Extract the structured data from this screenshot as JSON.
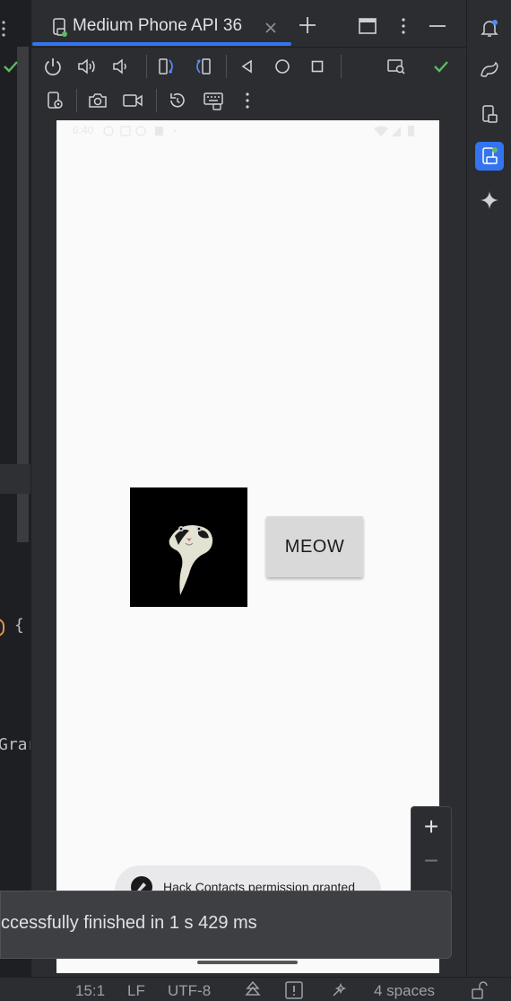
{
  "colors": {
    "accent": "#3574f0",
    "success": "#5fb865",
    "device_online": "#5fb865"
  },
  "editor_fragments": {
    "brace": "{",
    "word": "Grar"
  },
  "tab": {
    "title": "Medium Phone API 36",
    "icon": "device-icon",
    "close_icon": "close-icon",
    "add_icon": "plus-icon"
  },
  "window_controls": {
    "restore": "window-icon",
    "more": "more-vertical-icon",
    "minimize": "minimize-icon"
  },
  "toolbar_row1": [
    "power-icon",
    "volume-up-icon",
    "volume-down-icon",
    "rotate-left-icon",
    "rotate-right-icon",
    "back-icon",
    "home-icon",
    "overview-icon",
    "snapshot-view-icon",
    "check-icon"
  ],
  "toolbar_row2": [
    "device-settings-icon",
    "camera-icon",
    "record-icon",
    "reset-icon",
    "keyboard-icon",
    "more-vertical-icon"
  ],
  "right_tools": [
    "notifications-icon",
    "gradle-icon",
    "device-manager-icon",
    "running-devices-icon",
    "gemini-icon"
  ],
  "device": {
    "status_time": "6:40",
    "button_label": "MEOW",
    "image": "cat-photo",
    "toast": "Hack Contacts permission granted"
  },
  "zoom": {
    "in": "+",
    "out": "−"
  },
  "notification": {
    "text": "ccessfully finished in 1 s 429 ms"
  },
  "status_bar": {
    "position": "15:1",
    "line_ending": "LF",
    "encoding": "UTF-8",
    "indent": "4 spaces"
  }
}
